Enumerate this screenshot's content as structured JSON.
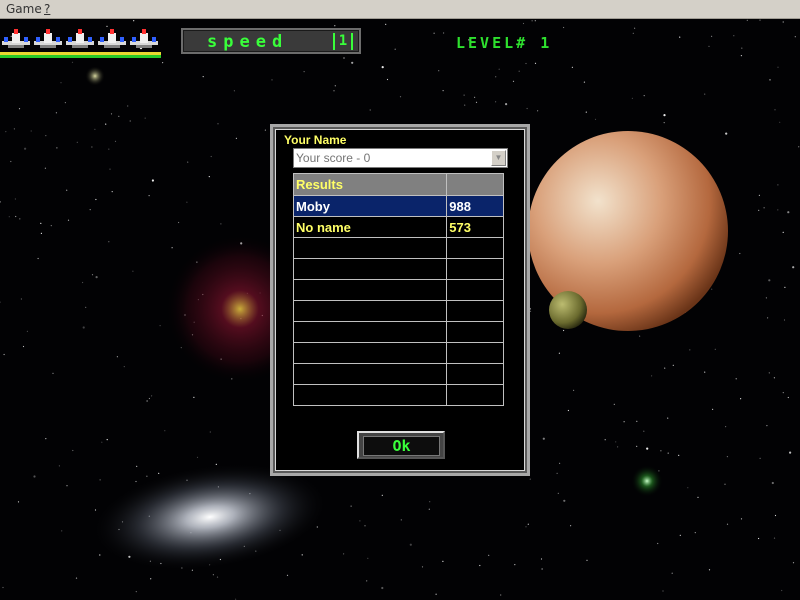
{
  "menu": {
    "game": "Game",
    "help": "?"
  },
  "hud": {
    "lives": 5,
    "speed_label": "speed",
    "speed_value": "1",
    "level_text": "LEVEL# 1"
  },
  "dialog": {
    "name_label": "Your Name",
    "name_input": {
      "value": "",
      "placeholder": "Your score - 0"
    },
    "results_header": "Results",
    "rows": [
      {
        "name": "Moby",
        "score": "988"
      },
      {
        "name": "No name",
        "score": "573"
      }
    ],
    "ok_label": "Ok"
  },
  "colors": {
    "hud_green": "#39ff3a",
    "text_yellow": "#ffff66",
    "selection_blue": "#0a246a"
  }
}
